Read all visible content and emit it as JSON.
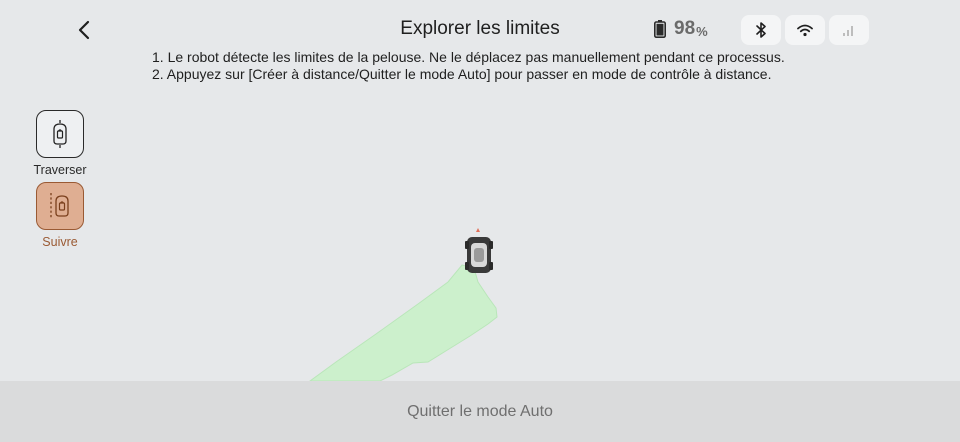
{
  "header": {
    "title": "Explorer les limites",
    "battery_value": "98",
    "battery_unit": "%",
    "back_icon": "chevron-left-icon",
    "status_icons": [
      "bluetooth-icon",
      "wifi-icon",
      "cellular-signal-icon"
    ]
  },
  "instructions": {
    "line1": "1. Le robot détecte les limites de la pelouse. Ne le déplacez pas manuellement pendant ce processus.",
    "line2": "2. Appuyez sur [Créer à distance/Quitter le mode Auto] pour passer en mode de contrôle à distance."
  },
  "modes": {
    "traverse_label": "Traverser",
    "follow_label": "Suivre",
    "selected": "Suivre"
  },
  "footer": {
    "exit_auto_label": "Quitter le mode Auto"
  },
  "colors": {
    "background": "#e6e8ea",
    "mapped_area": "#ccf0cc",
    "active_mode": "#dfae92",
    "active_mode_text": "#9a5a34",
    "robot_heading": "#e0705a"
  }
}
